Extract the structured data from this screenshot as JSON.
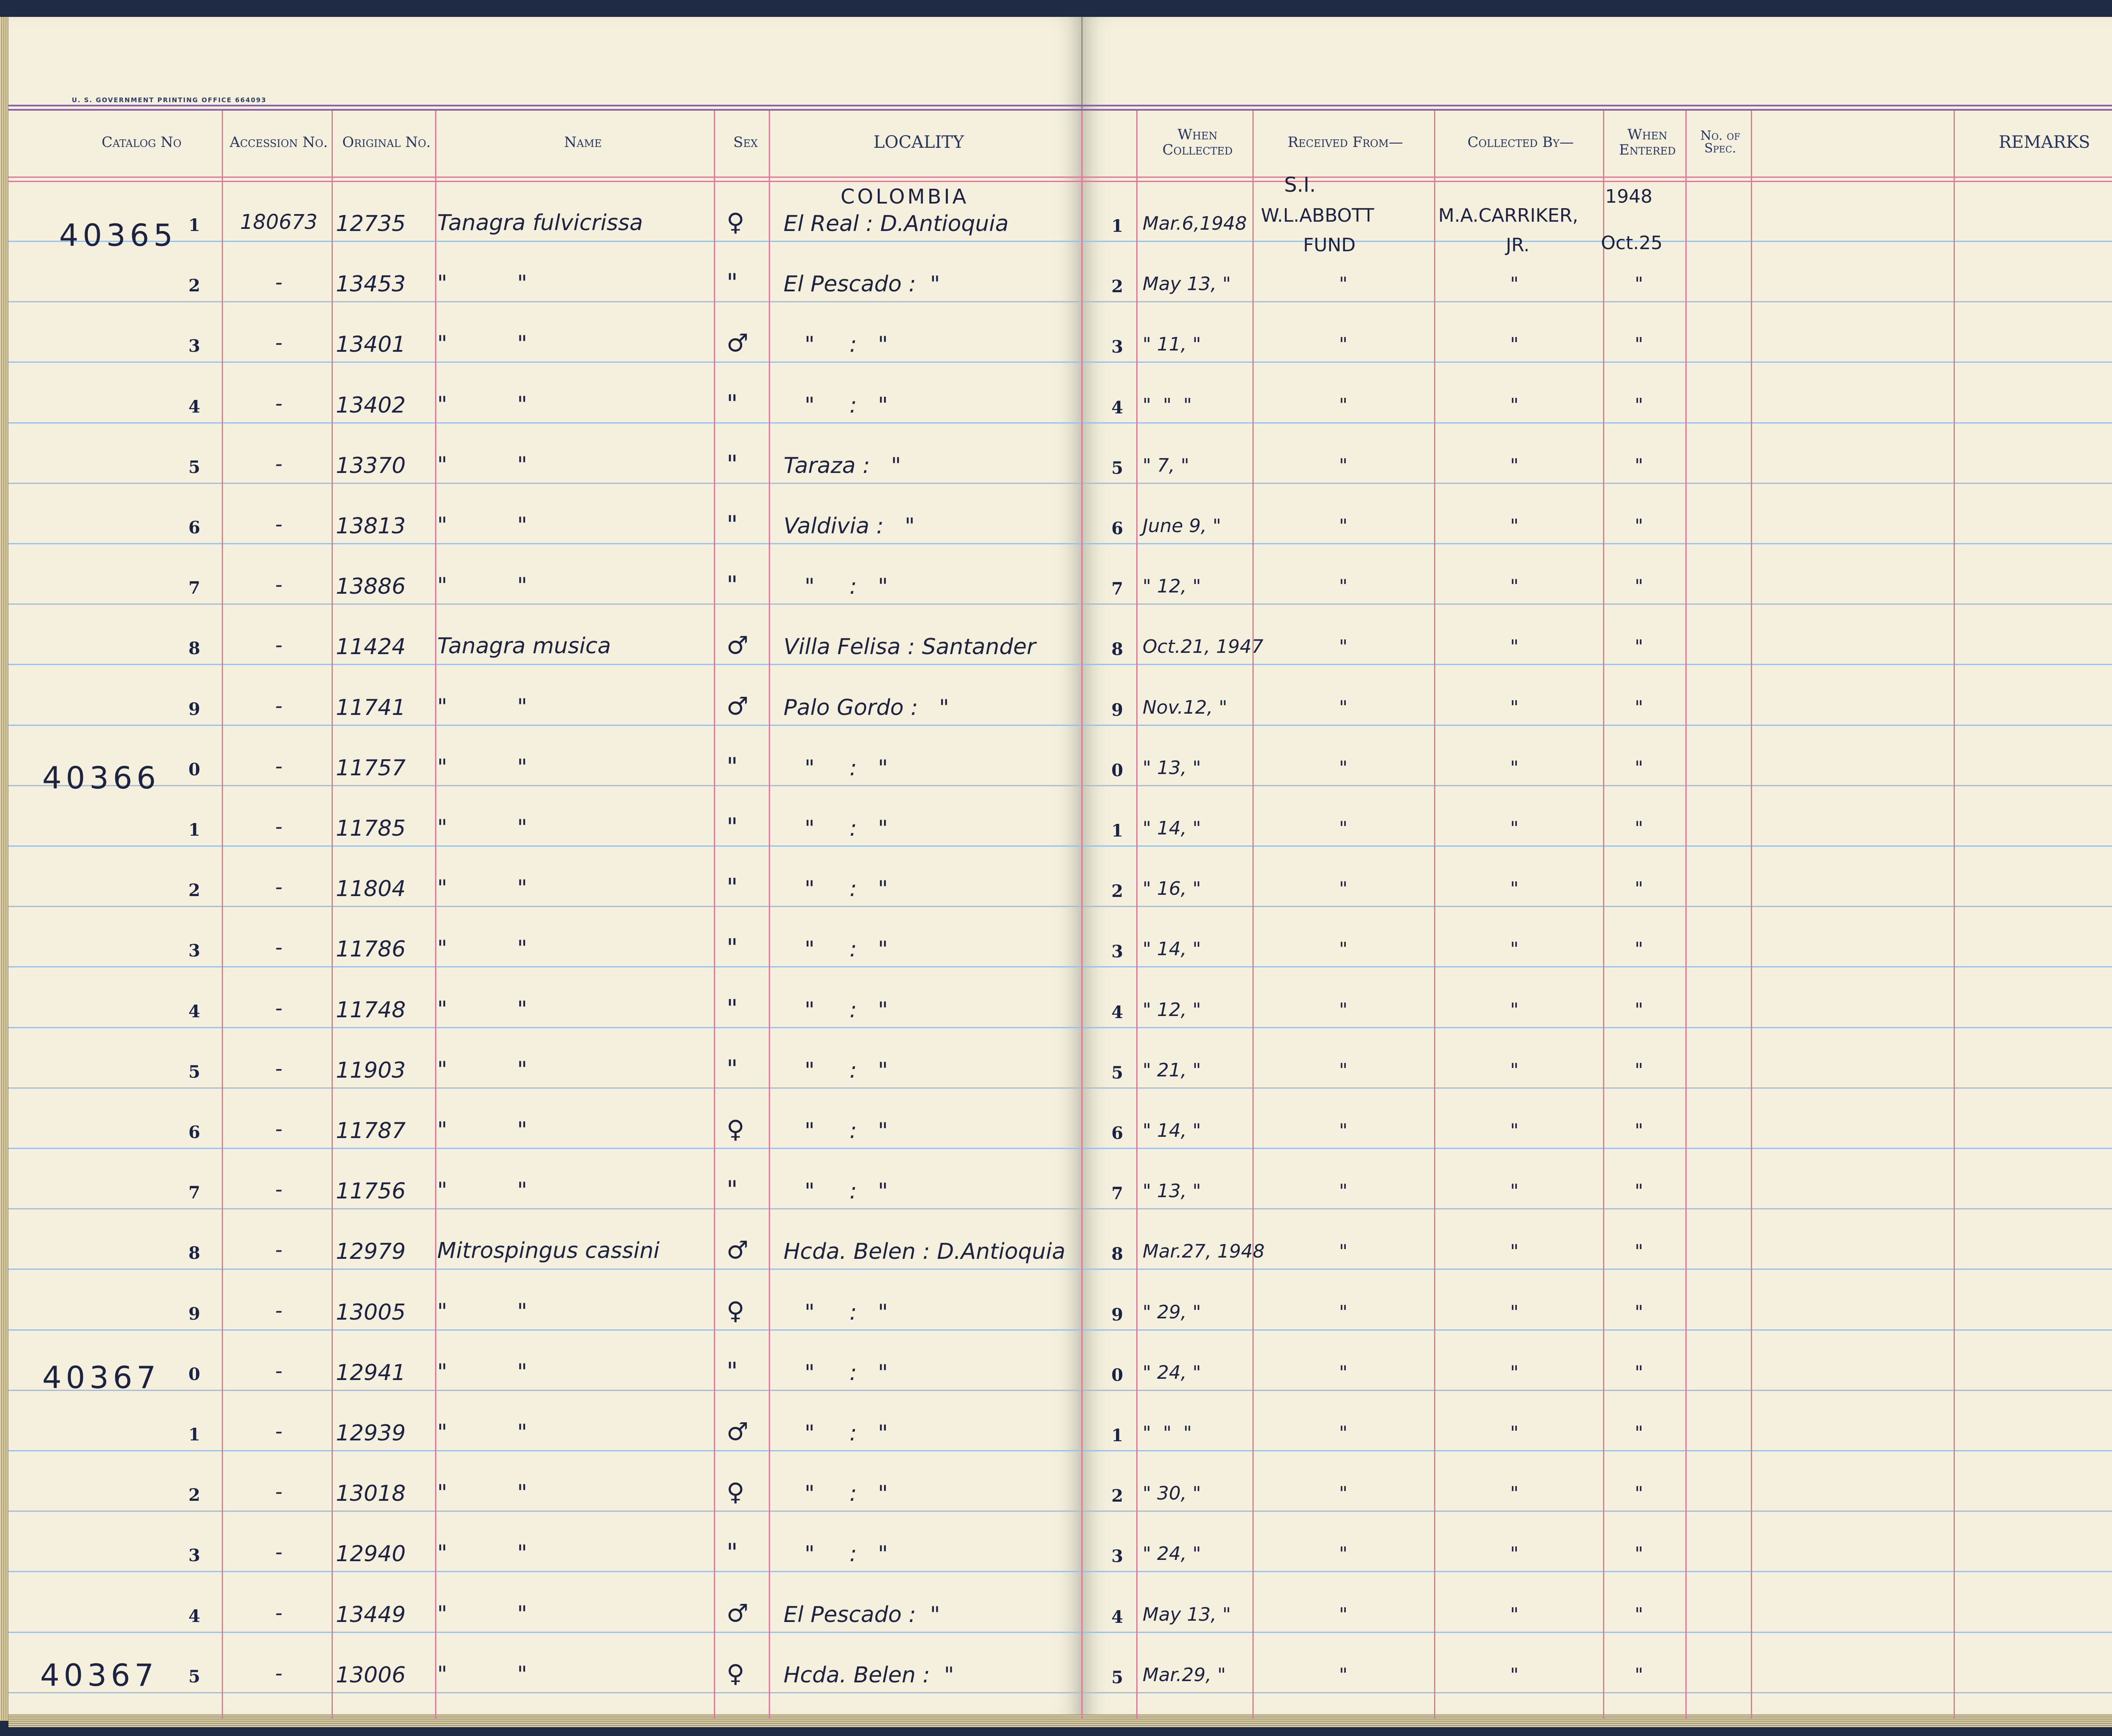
{
  "printer_line": "U. S. GOVERNMENT PRINTING OFFICE    664093",
  "headers": {
    "catalog": "Catalog No",
    "accession": "Accession No.",
    "original": "Original No.",
    "name": "Name",
    "sex": "Sex",
    "locality": "LOCALITY",
    "when_collected": "When Collected",
    "received_from": "Received From—",
    "collected_by": "Collected By—",
    "when_entered": "When Entered",
    "no_of_spec": "No. of Spec.",
    "remarks": "REMARKS"
  },
  "country": "COLOMBIA",
  "received_from_text": [
    "S.I.",
    "W.L.ABBOTT",
    "FUND"
  ],
  "collected_by_text": [
    "M.A.CARRIKER,",
    "JR."
  ],
  "when_entered_text": [
    "1948",
    "Oct.25"
  ],
  "catalog_prefixes": [
    "40365",
    "40366",
    "40367",
    "40367"
  ],
  "rows": [
    {
      "line": "1",
      "accession": "180673",
      "original": "12735",
      "name": "Tanagra fulvicrissa",
      "sex": "♀",
      "locality": "El Real : D.Antioquia",
      "rline": "1",
      "date": "Mar.6,1948",
      "recv": "",
      "coll": "",
      "entered": ""
    },
    {
      "line": "2",
      "accession": "-",
      "original": "13453",
      "name": "\"          \"",
      "sex": "\"",
      "locality": "El Pescado :  \"",
      "rline": "2",
      "date": "May 13, \"",
      "recv": "\"",
      "coll": "\"",
      "entered": "\""
    },
    {
      "line": "3",
      "accession": "-",
      "original": "13401",
      "name": "\"          \"",
      "sex": "♂",
      "locality": "   \"     :   \"",
      "rline": "3",
      "date": "\" 11, \"",
      "recv": "\"",
      "coll": "\"",
      "entered": "\""
    },
    {
      "line": "4",
      "accession": "-",
      "original": "13402",
      "name": "\"          \"",
      "sex": "\"",
      "locality": "   \"     :   \"",
      "rline": "4",
      "date": "\"  \"  \"",
      "recv": "\"",
      "coll": "\"",
      "entered": "\""
    },
    {
      "line": "5",
      "accession": "-",
      "original": "13370",
      "name": "\"          \"",
      "sex": "\"",
      "locality": "Taraza :   \"",
      "rline": "5",
      "date": "\" 7, \"",
      "recv": "\"",
      "coll": "\"",
      "entered": "\""
    },
    {
      "line": "6",
      "accession": "-",
      "original": "13813",
      "name": "\"          \"",
      "sex": "\"",
      "locality": "Valdivia :   \"",
      "rline": "6",
      "date": "June 9, \"",
      "recv": "\"",
      "coll": "\"",
      "entered": "\""
    },
    {
      "line": "7",
      "accession": "-",
      "original": "13886",
      "name": "\"          \"",
      "sex": "\"",
      "locality": "   \"     :   \"",
      "rline": "7",
      "date": "\" 12, \"",
      "recv": "\"",
      "coll": "\"",
      "entered": "\""
    },
    {
      "line": "8",
      "accession": "-",
      "original": "11424",
      "name": "Tanagra musica",
      "sex": "♂",
      "locality": "Villa Felisa : Santander",
      "rline": "8",
      "date": "Oct.21, 1947",
      "recv": "\"",
      "coll": "\"",
      "entered": "\""
    },
    {
      "line": "9",
      "accession": "-",
      "original": "11741",
      "name": "\"          \"",
      "sex": "♂",
      "locality": "Palo Gordo :   \"",
      "rline": "9",
      "date": "Nov.12, \"",
      "recv": "\"",
      "coll": "\"",
      "entered": "\""
    },
    {
      "line": "0",
      "accession": "-",
      "original": "11757",
      "name": "\"          \"",
      "sex": "\"",
      "locality": "   \"     :   \"",
      "rline": "0",
      "date": "\" 13, \"",
      "recv": "\"",
      "coll": "\"",
      "entered": "\""
    },
    {
      "line": "1",
      "accession": "-",
      "original": "11785",
      "name": "\"          \"",
      "sex": "\"",
      "locality": "   \"     :   \"",
      "rline": "1",
      "date": "\" 14, \"",
      "recv": "\"",
      "coll": "\"",
      "entered": "\""
    },
    {
      "line": "2",
      "accession": "-",
      "original": "11804",
      "name": "\"          \"",
      "sex": "\"",
      "locality": "   \"     :   \"",
      "rline": "2",
      "date": "\" 16, \"",
      "recv": "\"",
      "coll": "\"",
      "entered": "\""
    },
    {
      "line": "3",
      "accession": "-",
      "original": "11786",
      "name": "\"          \"",
      "sex": "\"",
      "locality": "   \"     :   \"",
      "rline": "3",
      "date": "\" 14, \"",
      "recv": "\"",
      "coll": "\"",
      "entered": "\""
    },
    {
      "line": "4",
      "accession": "-",
      "original": "11748",
      "name": "\"          \"",
      "sex": "\"",
      "locality": "   \"     :   \"",
      "rline": "4",
      "date": "\" 12, \"",
      "recv": "\"",
      "coll": "\"",
      "entered": "\""
    },
    {
      "line": "5",
      "accession": "-",
      "original": "11903",
      "name": "\"          \"",
      "sex": "\"",
      "locality": "   \"     :   \"",
      "rline": "5",
      "date": "\" 21, \"",
      "recv": "\"",
      "coll": "\"",
      "entered": "\""
    },
    {
      "line": "6",
      "accession": "-",
      "original": "11787",
      "name": "\"          \"",
      "sex": "♀",
      "locality": "   \"     :   \"",
      "rline": "6",
      "date": "\" 14, \"",
      "recv": "\"",
      "coll": "\"",
      "entered": "\""
    },
    {
      "line": "7",
      "accession": "-",
      "original": "11756",
      "name": "\"          \"",
      "sex": "\"",
      "locality": "   \"     :   \"",
      "rline": "7",
      "date": "\" 13, \"",
      "recv": "\"",
      "coll": "\"",
      "entered": "\""
    },
    {
      "line": "8",
      "accession": "-",
      "original": "12979",
      "name": "Mitrospingus cassini",
      "sex": "♂",
      "locality": "Hcda. Belen : D.Antioquia",
      "rline": "8",
      "date": "Mar.27, 1948",
      "recv": "\"",
      "coll": "\"",
      "entered": "\""
    },
    {
      "line": "9",
      "accession": "-",
      "original": "13005",
      "name": "\"          \"",
      "sex": "♀",
      "locality": "   \"     :   \"",
      "rline": "9",
      "date": "\" 29, \"",
      "recv": "\"",
      "coll": "\"",
      "entered": "\""
    },
    {
      "line": "0",
      "accession": "-",
      "original": "12941",
      "name": "\"          \"",
      "sex": "\"",
      "locality": "   \"     :   \"",
      "rline": "0",
      "date": "\" 24, \"",
      "recv": "\"",
      "coll": "\"",
      "entered": "\""
    },
    {
      "line": "1",
      "accession": "-",
      "original": "12939",
      "name": "\"          \"",
      "sex": "♂",
      "locality": "   \"     :   \"",
      "rline": "1",
      "date": "\"  \"  \"",
      "recv": "\"",
      "coll": "\"",
      "entered": "\""
    },
    {
      "line": "2",
      "accession": "-",
      "original": "13018",
      "name": "\"          \"",
      "sex": "♀",
      "locality": "   \"     :   \"",
      "rline": "2",
      "date": "\" 30, \"",
      "recv": "\"",
      "coll": "\"",
      "entered": "\""
    },
    {
      "line": "3",
      "accession": "-",
      "original": "12940",
      "name": "\"          \"",
      "sex": "\"",
      "locality": "   \"     :   \"",
      "rline": "3",
      "date": "\" 24, \"",
      "recv": "\"",
      "coll": "\"",
      "entered": "\""
    },
    {
      "line": "4",
      "accession": "-",
      "original": "13449",
      "name": "\"          \"",
      "sex": "♂",
      "locality": "El Pescado :  \"",
      "rline": "4",
      "date": "May 13, \"",
      "recv": "\"",
      "coll": "\"",
      "entered": "\""
    },
    {
      "line": "5",
      "accession": "-",
      "original": "13006",
      "name": "\"          \"",
      "sex": "♀",
      "locality": "Hcda. Belen :  \"",
      "rline": "5",
      "date": "Mar.29, \"",
      "recv": "\"",
      "coll": "\"",
      "entered": "\""
    }
  ]
}
